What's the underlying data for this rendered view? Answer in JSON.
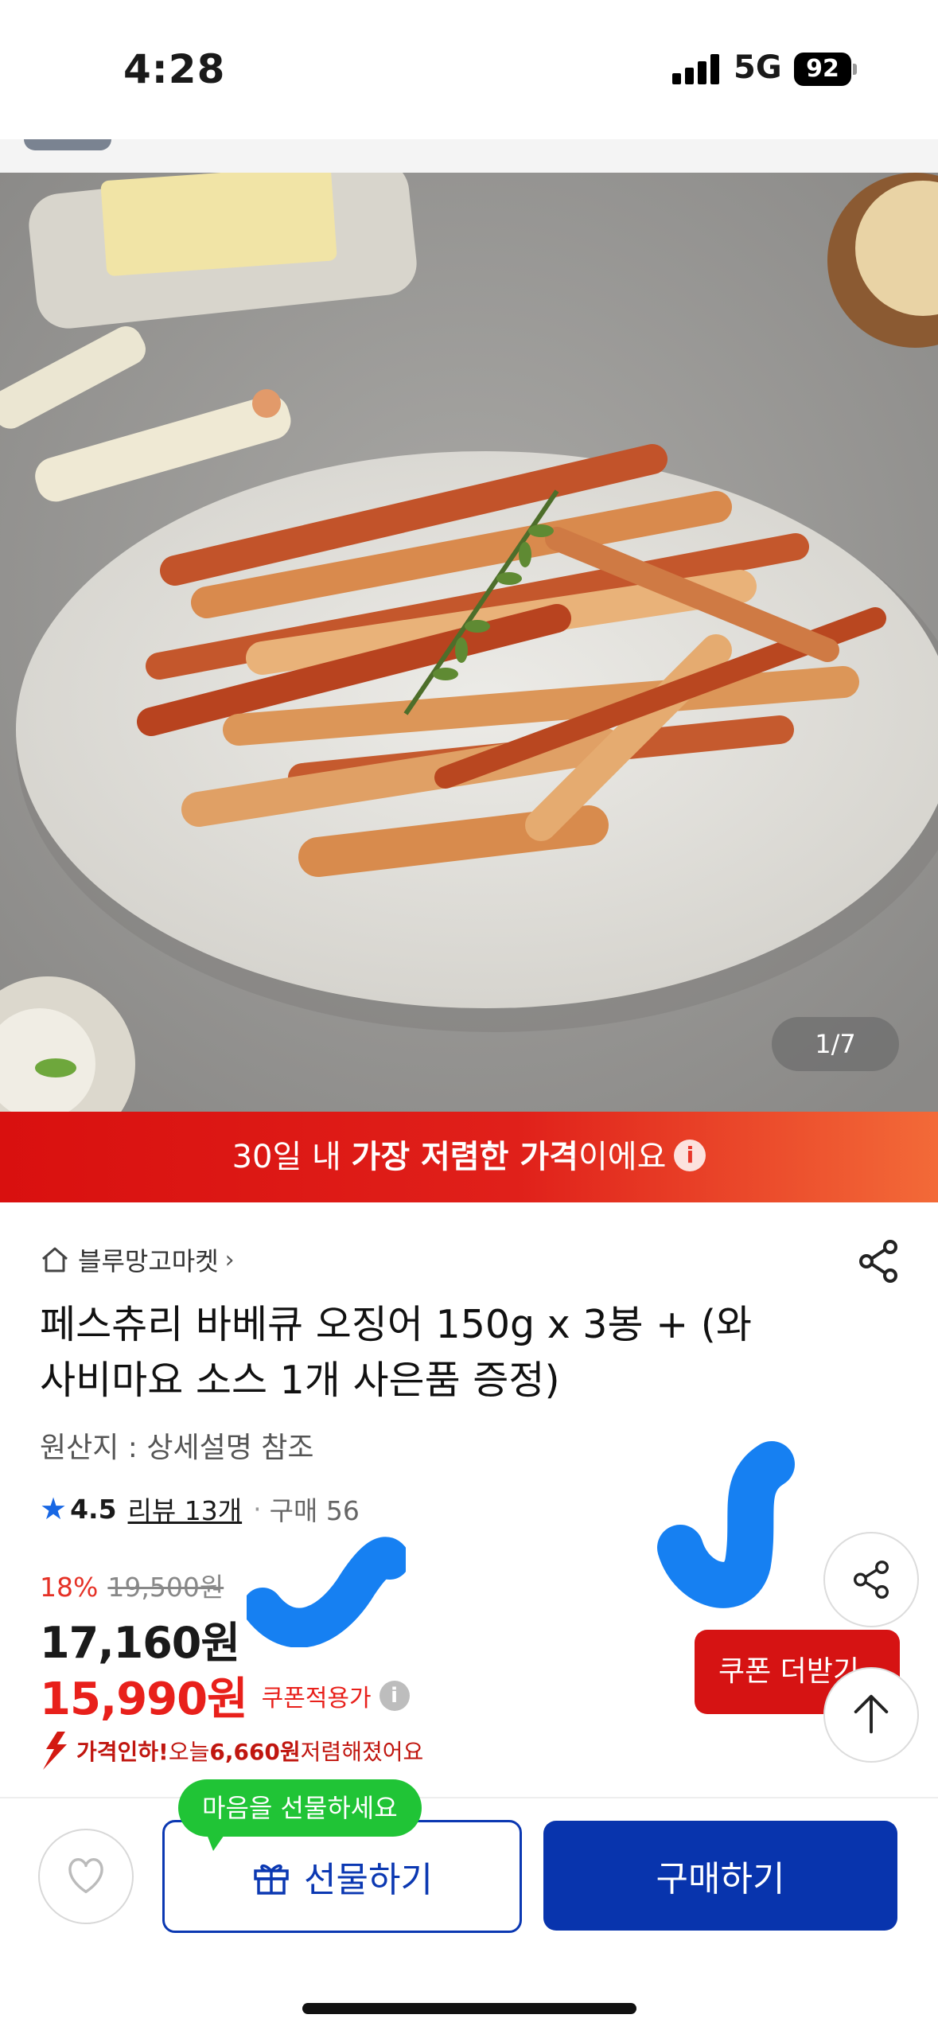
{
  "status_bar": {
    "time": "4:28",
    "network": "5G",
    "battery": "92"
  },
  "gallery": {
    "indicator": "1/7"
  },
  "banner": {
    "prefix": "30일 내 ",
    "emphasis": "가장 저렴한 가격",
    "suffix": "이에요"
  },
  "store": {
    "name": "블루망고마켓"
  },
  "product": {
    "title_line1": "페스츄리 바베큐 오징어 150g x 3봉 + (와",
    "title_line2": "사비마요 소스 1개  사은품 증정)",
    "origin": "원산지 : 상세설명 참조"
  },
  "rating": {
    "score": "4.5",
    "reviews": "리뷰 13개",
    "purchases": "구매 56"
  },
  "pricing": {
    "discount_percent": "18%",
    "original_price": "19,500원",
    "sale_price": "17,160원",
    "coupon_price": "15,990원",
    "coupon_label": "쿠폰적용가",
    "drop_prefix": "가격인하!",
    "drop_mid": " 오늘 ",
    "drop_amount": "6,660원",
    "drop_suffix": " 저렴해졌어요"
  },
  "coupon_button": {
    "label": "쿠폰 더받기"
  },
  "bottom_bar": {
    "tooltip": "마음을 선물하세요",
    "gift_label": "선물하기",
    "buy_label": "구매하기"
  },
  "colors": {
    "brand_blue": "#0834ad",
    "price_red": "#e8201b",
    "banner_red": "#d9100f",
    "tooltip_green": "#20c436",
    "scribble_blue": "#1680f2"
  },
  "icons": [
    "home-icon",
    "chevron-right-icon",
    "share-icon",
    "star-icon",
    "info-icon",
    "price-drop-arrow-icon",
    "arrow-up-icon",
    "heart-icon",
    "gift-icon"
  ]
}
